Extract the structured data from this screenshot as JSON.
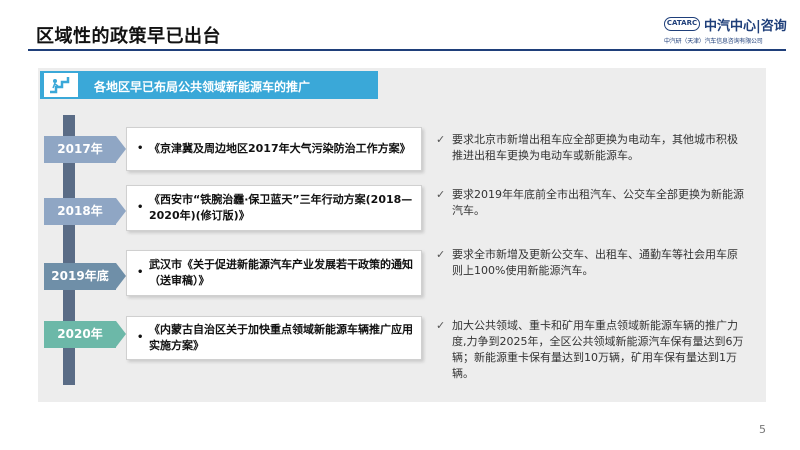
{
  "title": "区域性的政策早已出台",
  "logo": {
    "badge": "CATARC",
    "main": "中汽中心|咨询",
    "sub": "中汽研（天津）汽车信息咨询有限公司"
  },
  "banner": {
    "text": "各地区早已布局公共领域新能源车的推广"
  },
  "timeline": [
    {
      "year": "2017年",
      "policy": "《京津冀及周边地区2017年大气污染防治工作方案》",
      "requirement": "要求北京市新增出租车应全部更换为电动车，其他城市积极推进出租车更换为电动车或新能源车。"
    },
    {
      "year": "2018年",
      "policy": "《西安市“铁腕治霾·保卫蓝天”三年行动方案(2018—2020年)(修订版)》",
      "requirement": "要求2019年年底前全市出租汽车、公交车全部更换为新能源汽车。"
    },
    {
      "year": "2019年底",
      "policy": "武汉市《关于促进新能源汽车产业发展若干政策的通知（送审稿）》",
      "requirement": "要求全市新增及更新公交车、出租车、通勤车等社会用车原则上100%使用新能源汽车。"
    },
    {
      "year": "2020年",
      "policy": "《内蒙古自治区关于加快重点领域新能源车辆推广应用实施方案》",
      "requirement": "加大公共领域、重卡和矿用车重点领域新能源车辆的推广力度,力争到2025年，全区公共领域新能源汽车保有量达到6万辆；新能源重卡保有量达到10万辆，矿用车保有量达到1万辆。"
    }
  ],
  "page_number": "5",
  "colors": {
    "title_rule": "#1f3f7a",
    "banner": "#3aa8d8",
    "timeline_line": "#5a6c86",
    "year_1": "#8fa6c4",
    "year_2": "#8fa6c4",
    "year_3": "#6f8fa8",
    "year_4": "#6cb8a8"
  }
}
